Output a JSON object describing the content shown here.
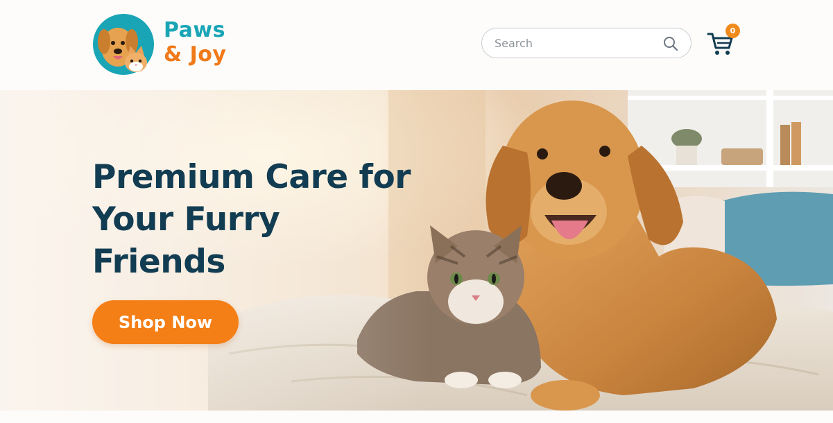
{
  "brand": {
    "name_line1": "Paws",
    "name_line2": "& Joy",
    "logo_icon": "dog-and-cat-logo-icon",
    "colors": {
      "primary": "#1aa5b7",
      "accent": "#f07a1a"
    }
  },
  "search": {
    "placeholder": "Search",
    "value": "",
    "icon": "search-icon"
  },
  "cart": {
    "icon": "shopping-cart-icon",
    "count": "0"
  },
  "hero": {
    "headline": "Premium Care for Your Furry Friends",
    "cta_label": "Shop Now",
    "image": "golden-retriever-and-tabby-cat-photo",
    "colors": {
      "headline": "#123c52",
      "cta": "#f57f17"
    }
  }
}
